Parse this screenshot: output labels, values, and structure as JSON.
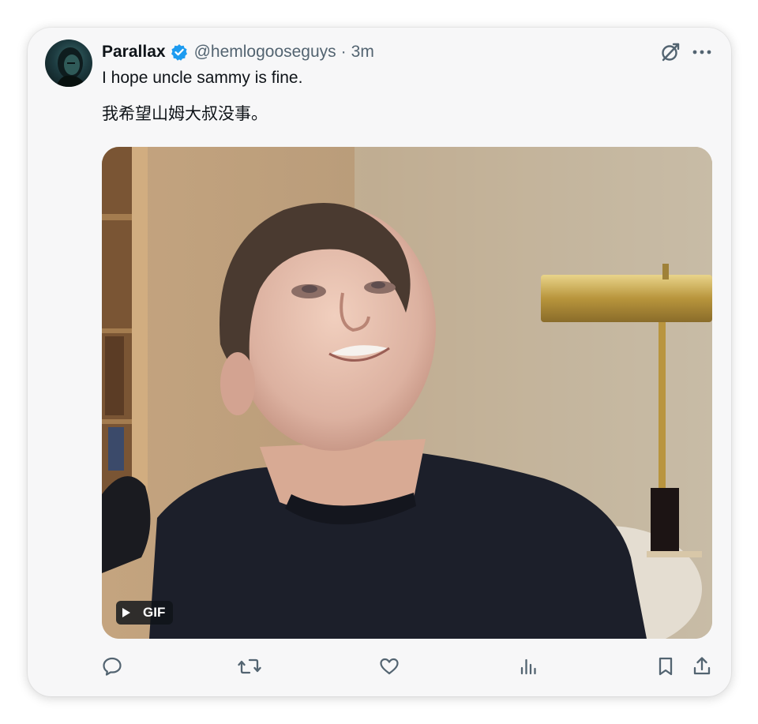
{
  "tweet": {
    "display_name": "Parallax",
    "handle": "@hemlogooseguys",
    "separator": "·",
    "time": "3m",
    "text_line1": "I hope uncle sammy is fine.",
    "text_line2": "我希望山姆大叔没事。",
    "verified": true
  },
  "media": {
    "type_label": "GIF",
    "icon": "play-icon"
  },
  "icons": {
    "header": [
      "grok-icon",
      "more-icon"
    ],
    "actions": [
      "reply-icon",
      "retweet-icon",
      "like-icon",
      "views-icon",
      "bookmark-icon",
      "share-icon"
    ]
  },
  "colors": {
    "text_primary": "#0f1419",
    "text_secondary": "#536471",
    "verified_blue": "#1d9bf0",
    "card_background": "#f7f7f8"
  }
}
